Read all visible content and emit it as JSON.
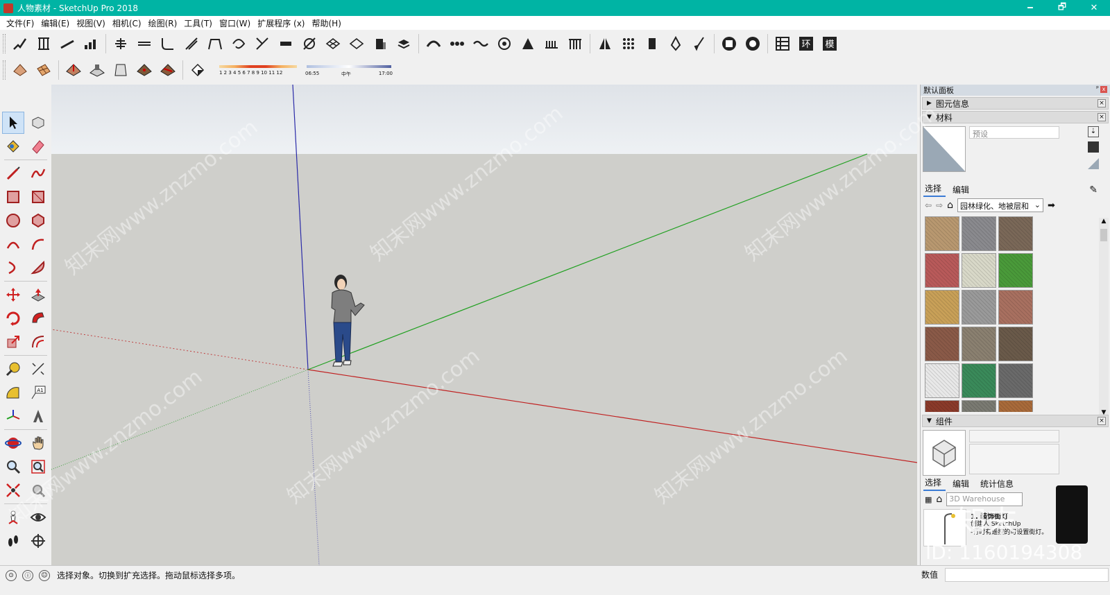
{
  "window": {
    "title": "人物素材 - SketchUp Pro 2018",
    "controls": [
      "🗕",
      "🗗",
      "✕"
    ]
  },
  "menu": [
    "文件(F)",
    "编辑(E)",
    "视图(V)",
    "相机(C)",
    "绘图(R)",
    "工具(T)",
    "窗口(W)",
    "扩展程序 (x)",
    "帮助(H)"
  ],
  "shadow_panel": {
    "months": "1 2 3 4 5 6 7 8 9 10 11 12",
    "time_start": "06:55",
    "time_mid": "中午",
    "time_end": "17:00"
  },
  "right_panel": {
    "title": "默认面板",
    "pin": "ᵖ",
    "close": "x",
    "trays": {
      "entity_info": "图元信息",
      "materials": "材料",
      "components": "组件"
    },
    "material_name_placeholder": "预设",
    "material_tabs": [
      "选择",
      "编辑"
    ],
    "material_collection": "园林绿化、地被层和",
    "component_tabs": [
      "选择",
      "编辑",
      "统计信息"
    ],
    "component_search_placeholder": "3D Warehouse",
    "component_item_title": "1. 装饰街灯",
    "component_item_desc": "创建人 SketchUp",
    "component_item_desc2": "-行时有遥控的可设置街灯。",
    "swatch_colors": [
      "#b89870",
      "#8a8a8e",
      "#7a6858",
      "#b85a5a",
      "#d8d8c8",
      "#4a9a3a",
      "#c8a058",
      "#9a9a9a",
      "#a87060",
      "#8a5a48",
      "#8a8070",
      "#6a5a4a",
      "#e8e8e8",
      "#3a8a5a",
      "#6a6a6a",
      "#8a3a2a",
      "#7a7a72",
      "#a86a3a"
    ]
  },
  "status": {
    "message": "选择对象。切换到扩充选择。拖动鼠标选择多项。",
    "measure_label": "数值"
  },
  "watermarks": {
    "text": "知末网www.znzmo.com",
    "id_text": "ID: 1160194308",
    "logo_text": "知末"
  }
}
